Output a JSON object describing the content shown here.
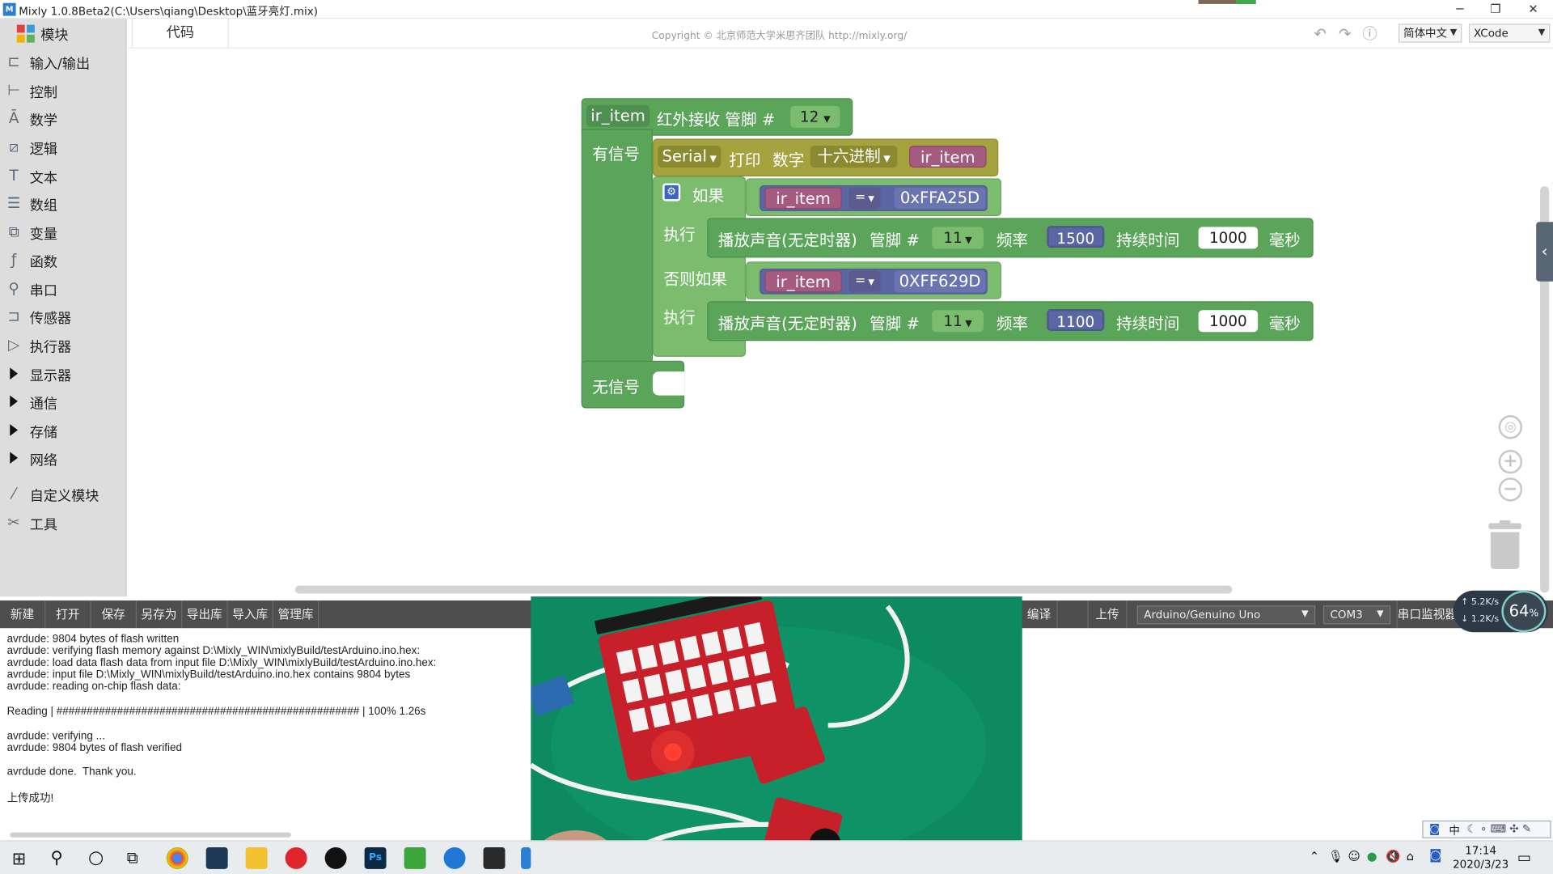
{
  "window": {
    "title": "Mixly 1.0.8Beta2(C:\\Users\\qiang\\Desktop\\蓝牙亮灯.mix)",
    "minimize": "─",
    "restore": "❐",
    "close": "✕"
  },
  "sidebar": {
    "header": "模块",
    "items": [
      {
        "label": "输入/输出",
        "icon": "io-icon"
      },
      {
        "label": "控制",
        "icon": "control-icon"
      },
      {
        "label": "数学",
        "icon": "math-icon"
      },
      {
        "label": "逻辑",
        "icon": "logic-icon"
      },
      {
        "label": "文本",
        "icon": "text-icon"
      },
      {
        "label": "数组",
        "icon": "list-icon"
      },
      {
        "label": "变量",
        "icon": "variable-icon"
      },
      {
        "label": "函数",
        "icon": "function-icon"
      },
      {
        "label": "串口",
        "icon": "serial-icon"
      },
      {
        "label": "传感器",
        "icon": "sensor-icon"
      },
      {
        "label": "执行器",
        "icon": "actuator-icon"
      }
    ],
    "groups": [
      "显示器",
      "通信",
      "存储",
      "网络"
    ],
    "extra": [
      {
        "label": "自定义模块",
        "icon": "custom-module-icon"
      },
      {
        "label": "工具",
        "icon": "tools-icon"
      }
    ]
  },
  "topbar": {
    "code_tab": "代码",
    "copyright": "Copyright © 北京师范大学米思齐团队 http://mixly.org/",
    "language": "简体中文",
    "theme": "XCode"
  },
  "blocks": {
    "ir": {
      "var": "ir_item",
      "label": "红外接收 管脚 #",
      "pin": "12"
    },
    "signal": "有信号",
    "no_signal": "无信号",
    "serial": {
      "port": "Serial",
      "print": "打印",
      "number": "数字",
      "format": "十六进制",
      "var": "ir_item"
    },
    "if_label": "如果",
    "elseif_label": "否则如果",
    "do_label": "执行",
    "cond1": {
      "var": "ir_item",
      "op": "=",
      "value": "0xFFA25D"
    },
    "cond2": {
      "var": "ir_item",
      "op": "=",
      "value": "0XFF629D"
    },
    "tone1": {
      "label": "播放声音(无定时器)",
      "pin_label": "管脚 #",
      "pin": "11",
      "freq_label": "频率",
      "freq": "1500",
      "dur_label": "持续时间",
      "dur": "1000",
      "unit": "毫秒"
    },
    "tone2": {
      "label": "播放声音(无定时器)",
      "pin_label": "管脚 #",
      "pin": "11",
      "freq_label": "频率",
      "freq": "1100",
      "dur_label": "持续时间",
      "dur": "1000",
      "unit": "毫秒"
    }
  },
  "toolbar": {
    "new": "新建",
    "open": "打开",
    "save": "保存",
    "save_as": "另存为",
    "export_lib": "导出库",
    "import_lib": "导入库",
    "manage_lib": "管理库",
    "compile": "编译",
    "upload": "上传",
    "board": "Arduino/Genuino Uno",
    "port": "COM3",
    "serial_monitor": "串口监视器"
  },
  "console": {
    "lines": [
      "avrdude: 9804 bytes of flash written",
      "avrdude: verifying flash memory against D:\\Mixly_WIN\\mixlyBuild/testArduino.ino.hex:",
      "avrdude: load data flash data from input file D:\\Mixly_WIN\\mixlyBuild/testArduino.ino.hex:",
      "avrdude: input file D:\\Mixly_WIN\\mixlyBuild/testArduino.ino.hex contains 9804 bytes",
      "avrdude: reading on-chip flash data:",
      "",
      "Reading | ################################################## | 100% 1.26s",
      "",
      "avrdude: verifying ...",
      "avrdude: 9804 bytes of flash verified",
      "",
      "avrdude done.  Thank you.",
      "",
      "上传成功!"
    ]
  },
  "speed_widget": {
    "up": "5.2",
    "up_unit": "K/s",
    "down": "1.2",
    "down_unit": "K/s",
    "percent": "64",
    "percent_unit": "%"
  },
  "taskbar": {
    "time": "17:14",
    "date": "2020/3/23",
    "ime": "中"
  }
}
